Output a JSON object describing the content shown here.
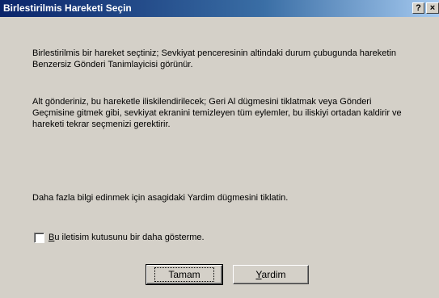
{
  "window": {
    "title": "Birlestirilmis Hareketi Seçin",
    "help_label": "?",
    "close_label": "×"
  },
  "content": {
    "paragraph1": "Birlestirilmis bir hareket seçtiniz; Sevkiyat penceresinin altindaki durum çubugunda hareketin Benzersiz Gönderi Tanimlayicisi görünür.",
    "paragraph2": "Alt gönderiniz, bu hareketle iliskilendirilecek; Geri Al dügmesini tiklatmak veya Gönderi Geçmisine gitmek gibi, sevkiyat ekranini temizleyen tüm eylemler, bu iliskiyi ortadan kaldirir ve hareketi tekrar seçmenizi gerektirir.",
    "paragraph3": "Daha fazla bilgi edinmek için asagidaki Yardim dügmesini tiklatin."
  },
  "checkbox": {
    "label_accel": "B",
    "label_rest": "u iletisim kutusunu bir daha gösterme.",
    "checked": false
  },
  "buttons": {
    "ok_label": "Tamam",
    "help_accel": "Y",
    "help_rest": "ardim"
  }
}
